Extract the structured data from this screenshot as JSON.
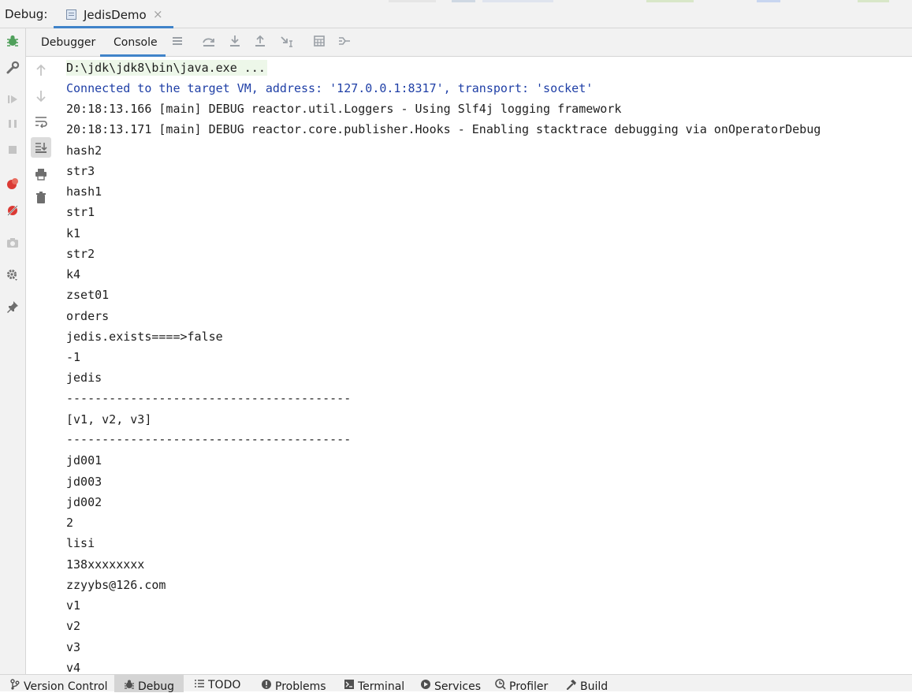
{
  "window": {
    "debug_label": "Debug:",
    "run_tab": "JedisDemo",
    "close_glyph": "×"
  },
  "subtabs": {
    "debugger": "Debugger",
    "console": "Console"
  },
  "console": {
    "lines": [
      "D:\\jdk\\jdk8\\bin\\java.exe ...",
      "Connected to the target VM, address: '127.0.0.1:8317', transport: 'socket'",
      "20:18:13.166 [main] DEBUG reactor.util.Loggers - Using Slf4j logging framework",
      "20:18:13.171 [main] DEBUG reactor.core.publisher.Hooks - Enabling stacktrace debugging via onOperatorDebug",
      "hash2",
      "str3",
      "hash1",
      "str1",
      "k1",
      "str2",
      "k4",
      "zset01",
      "orders",
      "jedis.exists====>false",
      "-1",
      "jedis",
      "----------------------------------------",
      "[v1, v2, v3]",
      "----------------------------------------",
      "jd001",
      "jd003",
      "jd002",
      "2",
      "lisi",
      "138xxxxxxxx",
      "zzyybs@126.com",
      "v1",
      "v2",
      "v3",
      "v4"
    ]
  },
  "bottom": {
    "version_control": "Version Control",
    "debug": "Debug",
    "todo": "TODO",
    "problems": "Problems",
    "terminal": "Terminal",
    "services": "Services",
    "profiler": "Profiler",
    "build": "Build"
  },
  "colors": {
    "accent": "#4083c9",
    "system_text": "#1f3fa6",
    "command_bg": "#edf7e9",
    "debug_green": "#4fa05b",
    "breakpoint_red": "#db3a34"
  }
}
